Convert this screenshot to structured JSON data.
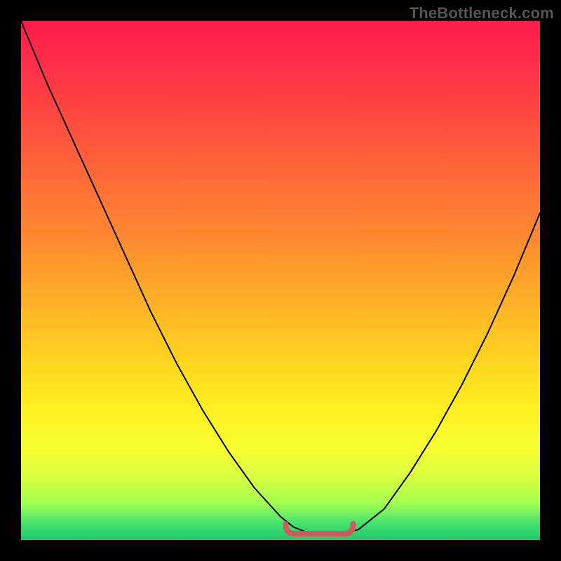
{
  "credit": "TheBottleneck.com",
  "colors": {
    "curve_stroke": "#000000",
    "minimum_marker": "#cd5c5c",
    "gradient_top": "#ff1a4a",
    "gradient_bottom": "#1fc96a"
  },
  "chart_data": {
    "type": "line",
    "title": "",
    "xlabel": "",
    "ylabel": "",
    "x": [
      0.0,
      0.05,
      0.1,
      0.15,
      0.2,
      0.25,
      0.3,
      0.35,
      0.4,
      0.45,
      0.5,
      0.525,
      0.55,
      0.58,
      0.6,
      0.62,
      0.65,
      0.7,
      0.75,
      0.8,
      0.85,
      0.9,
      0.95,
      1.0
    ],
    "y": [
      1.0,
      0.88,
      0.77,
      0.66,
      0.55,
      0.44,
      0.34,
      0.25,
      0.17,
      0.1,
      0.045,
      0.025,
      0.015,
      0.01,
      0.01,
      0.012,
      0.02,
      0.06,
      0.13,
      0.21,
      0.3,
      0.4,
      0.51,
      0.63
    ],
    "xlim": [
      0,
      1
    ],
    "ylim": [
      0,
      1
    ],
    "minimum_region_x": [
      0.51,
      0.64
    ],
    "minimum_region_y": 0.012,
    "annotations": []
  }
}
